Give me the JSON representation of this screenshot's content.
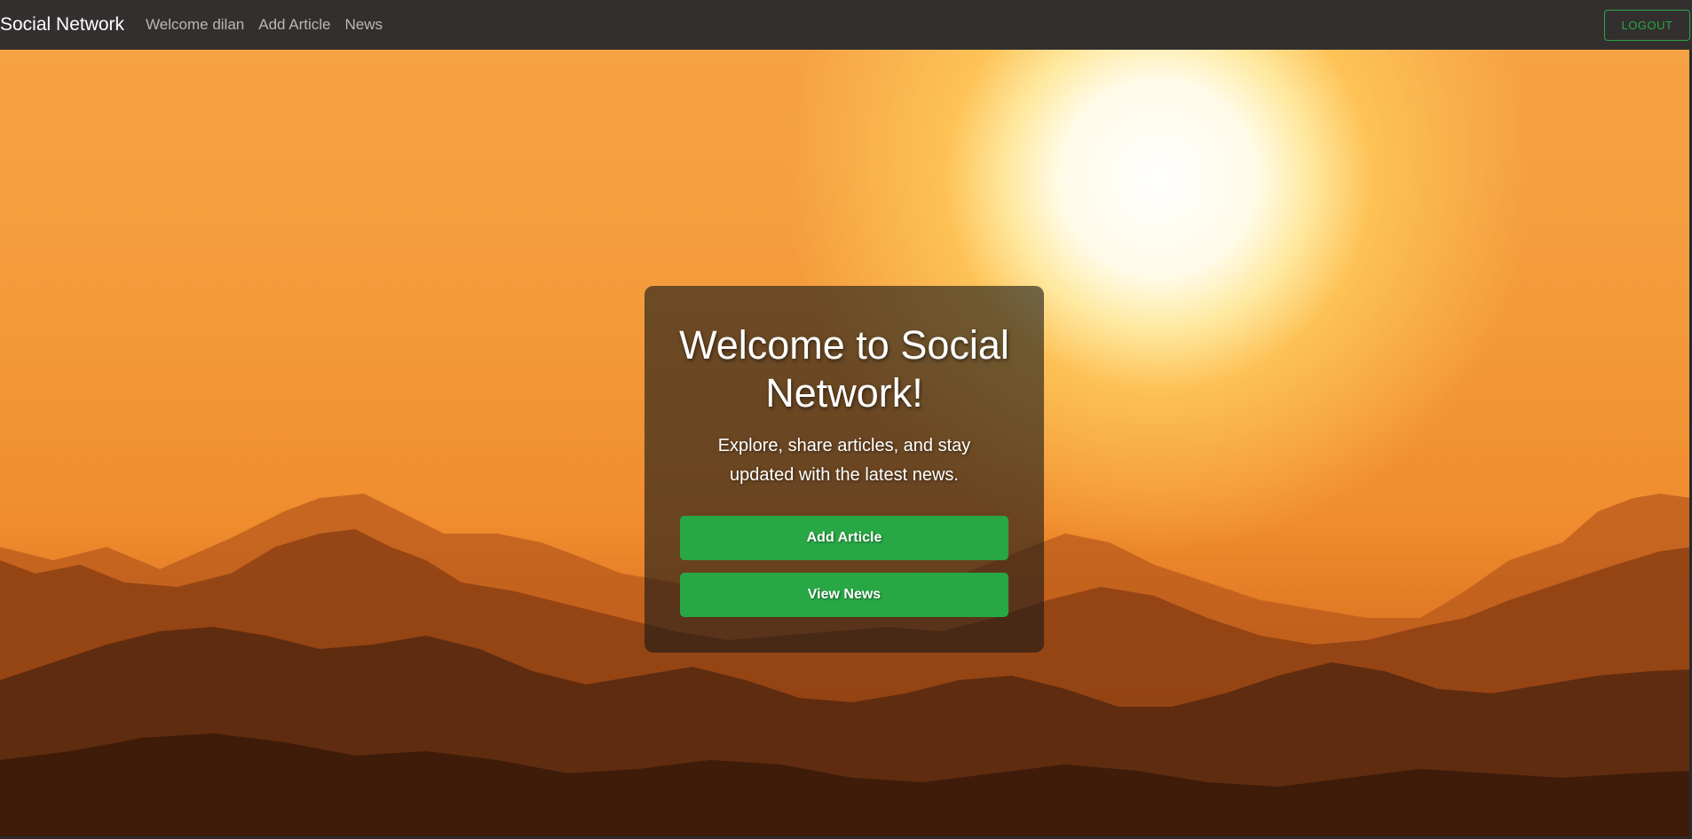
{
  "navbar": {
    "brand": "Social Network",
    "links": [
      {
        "label": "Welcome dilan"
      },
      {
        "label": "Add Article"
      },
      {
        "label": "News"
      }
    ],
    "logout_label": "LOGOUT"
  },
  "hero": {
    "title": "Welcome to Social Network!",
    "subtitle": "Explore, share articles, and stay updated with the latest news.",
    "buttons": {
      "add_article": "Add Article",
      "view_news": "View News"
    }
  },
  "colors": {
    "navbar_bg": "#332f2e",
    "accent_green": "#28a745",
    "sky_orange": "#f39a3a"
  }
}
